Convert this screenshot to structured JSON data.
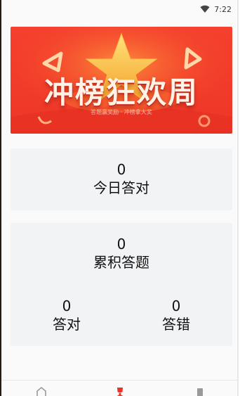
{
  "status_bar": {
    "time": "7:22",
    "wifi_icon": "wifi-icon"
  },
  "banner": {
    "title": "冲榜狂欢周",
    "subtitle": "答题赢奖励 · 冲榜拿大奖"
  },
  "today": {
    "value": "0",
    "label": "今日答对"
  },
  "total": {
    "value": "0",
    "label": "累积答题"
  },
  "correct": {
    "value": "0",
    "label": "答对"
  },
  "wrong": {
    "value": "0",
    "label": "答错"
  },
  "bottom_nav": {
    "items": [
      {
        "icon": "home-icon",
        "active": false
      },
      {
        "icon": "trophy-icon",
        "active": true
      },
      {
        "icon": "profile-icon",
        "active": false
      }
    ],
    "active_color": "#e8332a",
    "inactive_color": "#9a9a9a"
  },
  "colors": {
    "banner_red": "#e8332a",
    "banner_orange": "#ff7a2f",
    "card_bg": "#f2f3f5"
  }
}
